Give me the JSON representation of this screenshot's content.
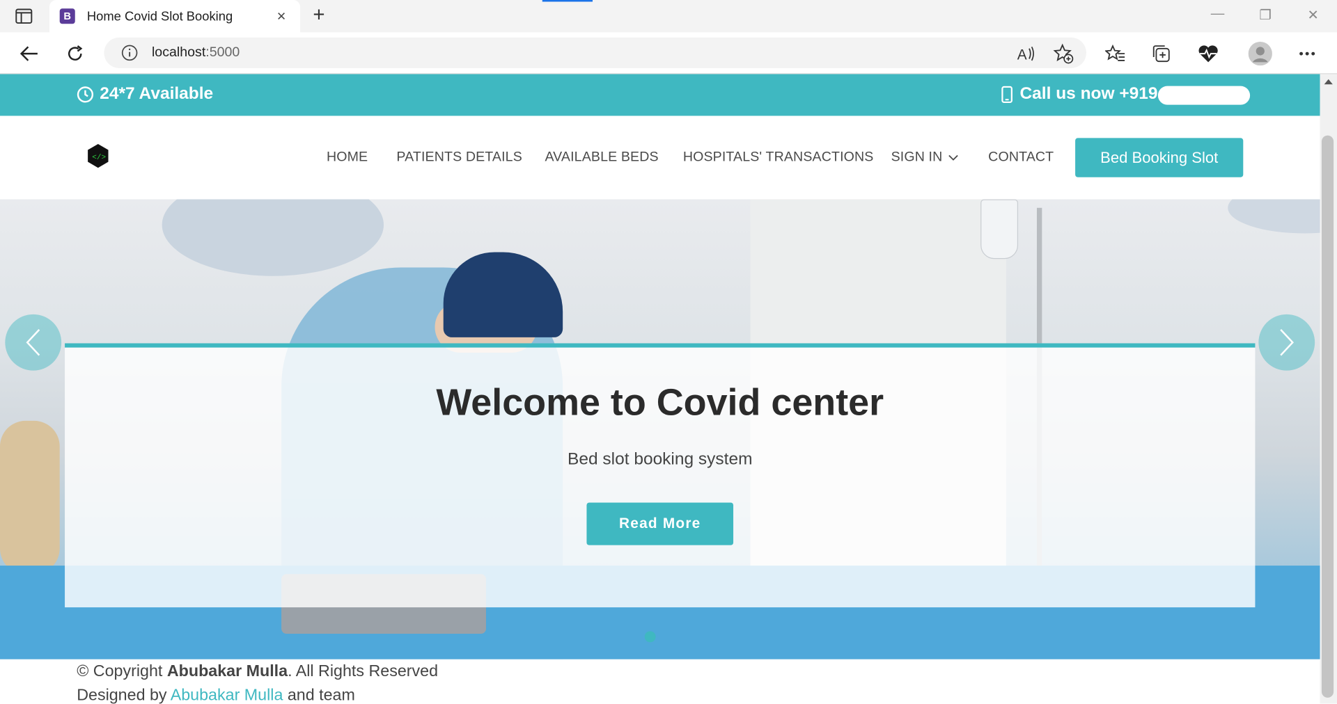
{
  "browser": {
    "tab_title": "Home Covid Slot Booking",
    "tab_favicon_letter": "B",
    "new_tab_symbol": "+",
    "close_tab_symbol": "×",
    "url_host": "localhost",
    "url_port": ":5000",
    "window_controls": [
      "—",
      "❐",
      "✕"
    ],
    "toolbar_icons": [
      "read-aloud-icon",
      "favorite-add-icon",
      "favorites-icon",
      "collections-icon",
      "health-icon",
      "profile-icon",
      "more-icon"
    ]
  },
  "topbar": {
    "availability": "24*7 Available",
    "call_text": "Call us now +919"
  },
  "navbar": {
    "items": [
      "HOME",
      "PATIENTS DETAILS",
      "AVAILABLE BEDS",
      "HOSPITALS' TRANSACTIONS",
      "SIGN IN",
      "CONTACT"
    ],
    "cta_label": "Bed Booking Slot"
  },
  "hero": {
    "title": "Welcome to Covid center",
    "subtitle": "Bed slot booking system",
    "button_label": "Read More"
  },
  "footer": {
    "copyright_prefix": "© Copyright ",
    "copyright_name": "Abubakar Mulla",
    "copyright_suffix": ". All Rights Reserved",
    "designed_prefix": "Designed by ",
    "designed_link": "Abubakar Mulla",
    "designed_suffix": " and team"
  },
  "colors": {
    "accent": "#3fb8c1",
    "text_dark": "#2b2b2b"
  }
}
